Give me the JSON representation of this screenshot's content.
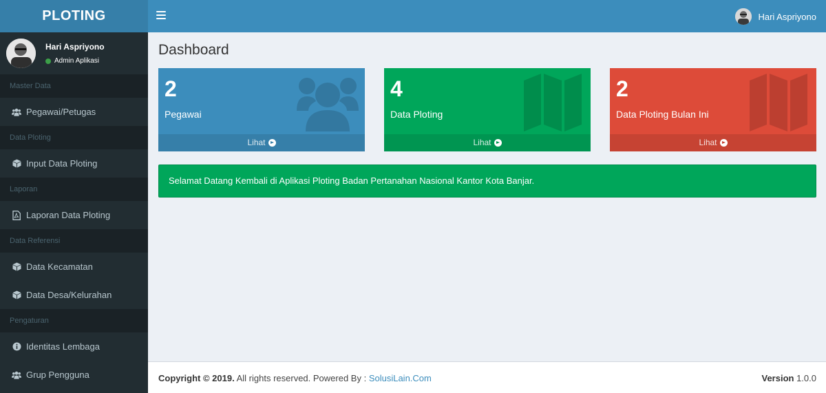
{
  "app": {
    "logo": "PLOTING"
  },
  "navbar": {
    "user_name": "Hari Aspriyono"
  },
  "sidebar": {
    "user": {
      "name": "Hari Aspriyono",
      "role": "Admin Aplikasi"
    },
    "sections": [
      {
        "header": "Master Data",
        "items": [
          {
            "label": "Pegawai/Petugas",
            "icon": "users-icon"
          }
        ]
      },
      {
        "header": "Data Ploting",
        "items": [
          {
            "label": "Input Data Ploting",
            "icon": "cube-icon"
          }
        ]
      },
      {
        "header": "Laporan",
        "items": [
          {
            "label": "Laporan Data Ploting",
            "icon": "pdf-file-icon"
          }
        ]
      },
      {
        "header": "Data Referensi",
        "items": [
          {
            "label": "Data Kecamatan",
            "icon": "cube-icon"
          },
          {
            "label": "Data Desa/Kelurahan",
            "icon": "cube-icon"
          }
        ]
      },
      {
        "header": "Pengaturan",
        "items": [
          {
            "label": "Identitas Lembaga",
            "icon": "info-circle-icon"
          },
          {
            "label": "Grup Pengguna",
            "icon": "users-icon"
          }
        ]
      }
    ]
  },
  "main": {
    "title": "Dashboard",
    "boxes": [
      {
        "count": "2",
        "label": "Pegawai",
        "link": "Lihat",
        "color": "#3c8dbc",
        "icon": "users-icon"
      },
      {
        "count": "4",
        "label": "Data Ploting",
        "link": "Lihat",
        "color": "#00a65a",
        "icon": "map-icon"
      },
      {
        "count": "2",
        "label": "Data Ploting Bulan Ini",
        "link": "Lihat",
        "color": "#dd4b39",
        "icon": "map-icon"
      }
    ],
    "alert": "Selamat Datang Kembali di Aplikasi Ploting Badan Pertanahan Nasional Kantor Kota Banjar."
  },
  "footer": {
    "copyright": "Copyright © 2019.",
    "rights": " All rights reserved. Powered By : ",
    "powered_link": "SolusiLain.Com",
    "version_label": "Version",
    "version_value": " 1.0.0"
  }
}
